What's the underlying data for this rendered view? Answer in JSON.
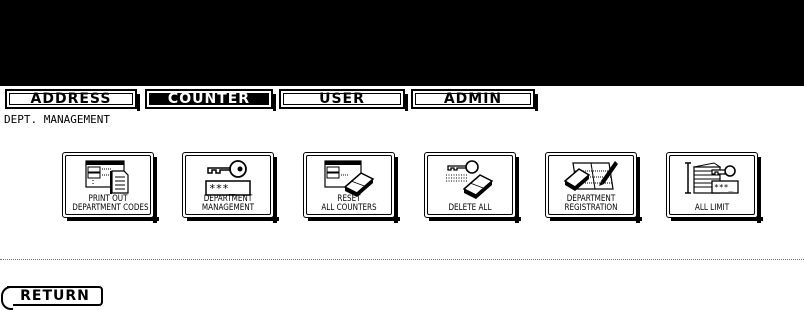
{
  "tabs": [
    {
      "label": "ADDRESS",
      "active": false
    },
    {
      "label": "COUNTER",
      "active": true
    },
    {
      "label": "USER",
      "active": false
    },
    {
      "label": "ADMIN",
      "active": false
    }
  ],
  "page_title": "DEPT. MANAGEMENT",
  "buttons": [
    {
      "lines": [
        "PRINT OUT",
        "DEPARTMENT CODES"
      ],
      "icon": "print-list-icon"
    },
    {
      "lines": [
        "DEPARTMENT",
        "MANAGEMENT"
      ],
      "icon": "key-password-icon"
    },
    {
      "lines": [
        "RESET",
        "ALL COUNTERS"
      ],
      "icon": "counter-eraser-icon"
    },
    {
      "lines": [
        "DELETE ALL"
      ],
      "icon": "key-eraser-icon"
    },
    {
      "lines": [
        "DEPARTMENT",
        "REGISTRATION"
      ],
      "icon": "register-pencil-icon"
    },
    {
      "lines": [
        "ALL LIMIT"
      ],
      "icon": "stack-key-icon"
    }
  ],
  "return_label": "RETURN",
  "colors": {
    "topbar": "#000000",
    "background": "#ffffff",
    "text": "#000000"
  }
}
